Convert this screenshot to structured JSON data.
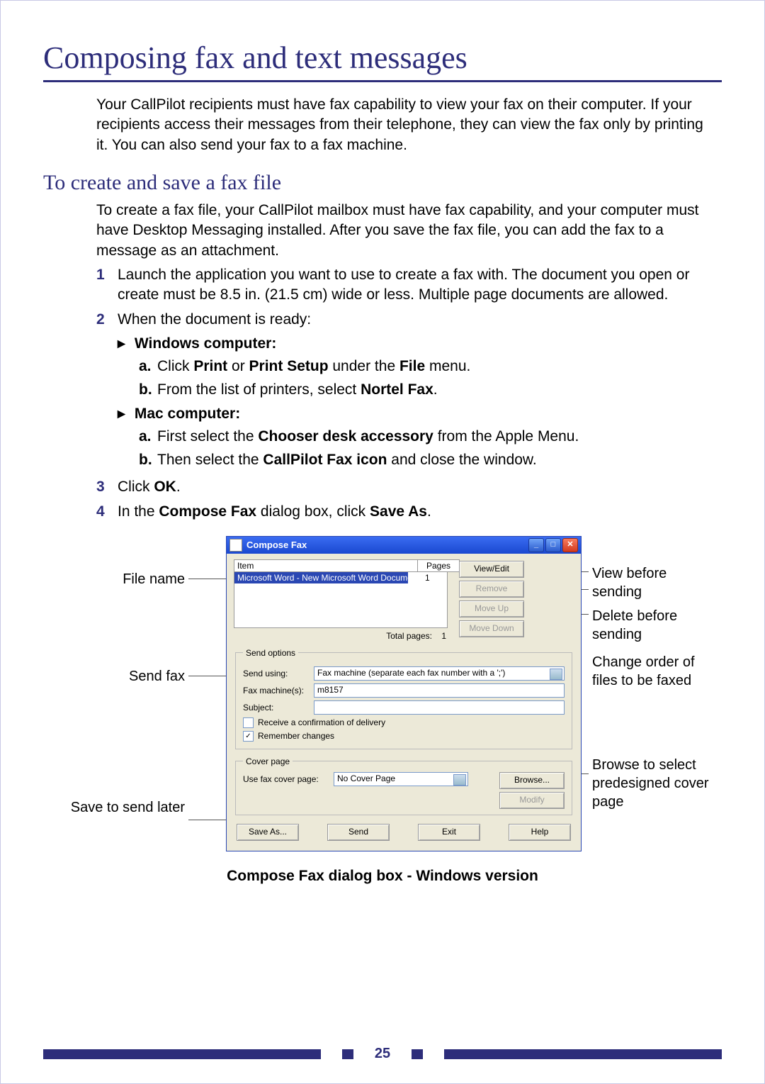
{
  "page": {
    "title": "Composing fax and text messages",
    "intro": "Your CallPilot recipients must have fax capability to view your fax on their computer. If your recipients access their messages from their telephone, they can view the fax only by printing it. You can also send your fax to a fax machine.",
    "section_heading": "To create and save a fax file",
    "section_intro": "To create a fax file, your CallPilot mailbox must have fax capability, and your computer must have Desktop Messaging installed. After you save the fax file, you can add the fax to a message as an attachment.",
    "steps": {
      "s1": {
        "num": "1",
        "text": "Launch the application you want to use to create a fax with. The document you open or create must be 8.5 in. (21.5 cm) wide or less. Multiple page documents are allowed."
      },
      "s2": {
        "num": "2",
        "text": "When the document is ready:"
      },
      "s2_win_head": "Windows computer:",
      "s2_win_a_prefix": "Click ",
      "s2_win_a_b1": "Print",
      "s2_win_a_mid": " or ",
      "s2_win_a_b2": "Print Setup",
      "s2_win_a_suffix": " under the ",
      "s2_win_a_b3": "File",
      "s2_win_a_end": " menu.",
      "s2_win_b_prefix": "From the list of printers, select ",
      "s2_win_b_b1": "Nortel Fax",
      "s2_win_b_end": ".",
      "s2_mac_head": "Mac computer:",
      "s2_mac_a_prefix": "First select the ",
      "s2_mac_a_b1": "Chooser desk accessory",
      "s2_mac_a_suffix": " from the Apple Menu.",
      "s2_mac_b_prefix": "Then select the ",
      "s2_mac_b_b1": "CallPilot Fax icon",
      "s2_mac_b_suffix": " and close the window.",
      "s3": {
        "num": "3",
        "pre": "Click ",
        "bold": "OK",
        "post": "."
      },
      "s4": {
        "num": "4",
        "pre": "In the ",
        "b1": "Compose Fax",
        "mid": " dialog box, click ",
        "b2": "Save As",
        "post": "."
      }
    },
    "caption": "Compose Fax dialog box - Windows version",
    "page_number": "25"
  },
  "callouts": {
    "left_filename": "File name",
    "left_sendfax": "Send fax",
    "left_save": "Save to send later",
    "right_view": "View before sending",
    "right_delete": "Delete before sending",
    "right_order": "Change order of files to be faxed",
    "right_browse": "Browse to select predesigned cover page"
  },
  "dialog": {
    "title": "Compose Fax",
    "col_item": "Item",
    "col_pages": "Pages",
    "row_item": "Microsoft Word - New Microsoft Word Document.d...",
    "row_pages": "1",
    "btn_view": "View/Edit",
    "btn_remove": "Remove",
    "btn_moveup": "Move Up",
    "btn_movedown": "Move Down",
    "total_label": "Total pages:",
    "total_value": "1",
    "send_options_legend": "Send options",
    "lbl_send_using": "Send using:",
    "val_send_using": "Fax machine (separate each fax number with a ';')",
    "lbl_fax_machines": "Fax machine(s):",
    "val_fax_machines": "m8157",
    "lbl_subject": "Subject:",
    "val_subject": "",
    "cb_receive": "Receive a confirmation of delivery",
    "cb_remember": "Remember changes",
    "cover_legend": "Cover page",
    "lbl_cover": "Use fax cover page:",
    "val_cover": "No Cover Page",
    "btn_browse": "Browse...",
    "btn_modify": "Modify",
    "btn_saveas": "Save As...",
    "btn_send": "Send",
    "btn_exit": "Exit",
    "btn_help": "Help"
  }
}
